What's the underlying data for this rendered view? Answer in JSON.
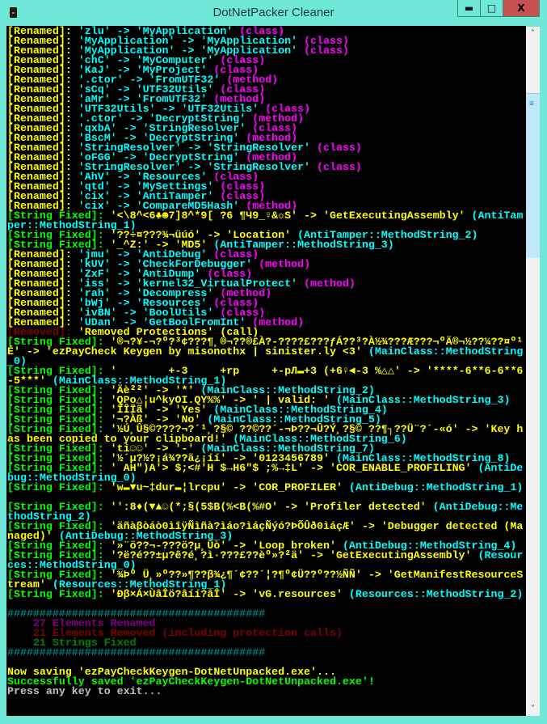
{
  "window": {
    "title": "DotNetPacker Cleaner",
    "minimize": "▬",
    "maximize": "□",
    "close": "X"
  },
  "colors": {
    "yellow": "#ffff00",
    "cyan": "#00ffff",
    "magenta": "#ff00ff",
    "green": "#00ff00",
    "darkred": "#800000",
    "purple": "#800080",
    "darkgreen": "#008000",
    "teal": "#008080",
    "gray": "#c0c0c0"
  },
  "lines": [
    {
      "type": "renamed",
      "label": "[Renamed]: ",
      "body": "'zlu' -> 'MyApplication' ",
      "tag": "(class)"
    },
    {
      "type": "renamed",
      "label": "[Renamed]: ",
      "body": "'MyApplication' -> 'MyApplication' ",
      "tag": "(class)"
    },
    {
      "type": "renamed",
      "label": "[Renamed]: ",
      "body": "'MyApplication' -> 'MyApplication' ",
      "tag": "(class)"
    },
    {
      "type": "renamed",
      "label": "[Renamed]: ",
      "body": "'chC' -> 'MyComputer' ",
      "tag": "(class)"
    },
    {
      "type": "renamed",
      "label": "[Renamed]: ",
      "body": "'KaJ' -> 'MyProject' ",
      "tag": "(class)"
    },
    {
      "type": "renamed",
      "label": "[Renamed]: ",
      "body": "'.ctor' -> 'FromUTF32' ",
      "tag": "(method)"
    },
    {
      "type": "renamed",
      "label": "[Renamed]: ",
      "body": "'sCq' -> 'UTF32Utils' ",
      "tag": "(class)"
    },
    {
      "type": "renamed",
      "label": "[Renamed]: ",
      "body": "'aMr' -> 'FromUTF32' ",
      "tag": "(method)"
    },
    {
      "type": "renamed",
      "label": "[Renamed]: ",
      "body": "'UTF32Utils' -> 'UTF32Utils' ",
      "tag": "(class)"
    },
    {
      "type": "renamed",
      "label": "[Renamed]: ",
      "body": "'.ctor' -> 'DecryptString' ",
      "tag": "(method)"
    },
    {
      "type": "renamed",
      "label": "[Renamed]: ",
      "body": "'qxbA' -> 'StringResolver' ",
      "tag": "(class)"
    },
    {
      "type": "renamed",
      "label": "[Renamed]: ",
      "body": "'BscM' -> 'DecryptString' ",
      "tag": "(method)"
    },
    {
      "type": "renamed",
      "label": "[Renamed]: ",
      "body": "'StringResolver' -> 'StringResolver' ",
      "tag": "(class)"
    },
    {
      "type": "renamed",
      "label": "[Renamed]: ",
      "body": "'oFGG' -> 'DecryptString' ",
      "tag": "(method)"
    },
    {
      "type": "renamed",
      "label": "[Renamed]: ",
      "body": "'StringResolver' -> 'StringResolver' ",
      "tag": "(class)"
    },
    {
      "type": "renamed",
      "label": "[Renamed]: ",
      "body": "'AhV' -> 'Resources' ",
      "tag": "(class)"
    },
    {
      "type": "renamed",
      "label": "[Renamed]: ",
      "body": "'qtd' -> 'MySettings' ",
      "tag": "(class)"
    },
    {
      "type": "renamed",
      "label": "[Renamed]: ",
      "body": "'cix' -> 'AntiTamper' ",
      "tag": "(class)"
    },
    {
      "type": "renamed",
      "label": "[Renamed]: ",
      "body": "'cix' -> 'CompareMD5Hash' ",
      "tag": "(method)"
    },
    {
      "type": "string",
      "label": "[String Fixed]: ",
      "body": "'<\\8^<6♣☻7]8^*9[ ?6 ¶Ч9_♀&☼S' -> 'GetExecutingAssembly' ",
      "tag": "(AntiTamper::MethodString_1)"
    },
    {
      "type": "string",
      "label": "[String Fixed]: ",
      "body": "'??÷¤???¾¬üúó' -> 'Location' ",
      "tag": "(AntiTamper::MethodString_2)"
    },
    {
      "type": "string",
      "label": "[String Fixed]: ",
      "body": "'_^Z:' -> 'MD5' ",
      "tag": "(AntiTamper::MethodString_3)"
    },
    {
      "type": "renamed",
      "label": "[Renamed]: ",
      "body": "'jmu' -> 'AntiDebug' ",
      "tag": "(class)"
    },
    {
      "type": "renamed",
      "label": "[Renamed]: ",
      "body": "'kUV' -> 'CheckForDebugger' ",
      "tag": "(method)"
    },
    {
      "type": "renamed",
      "label": "[Renamed]: ",
      "body": "'ZxF' -> 'AntiDump' ",
      "tag": "(class)"
    },
    {
      "type": "renamed",
      "label": "[Renamed]: ",
      "body": "'iss' -> 'kernel32_VirtualProtect' ",
      "tag": "(method)"
    },
    {
      "type": "renamed",
      "label": "[Renamed]: ",
      "body": "'rah' -> 'Decompress' ",
      "tag": "(method)"
    },
    {
      "type": "renamed",
      "label": "[Renamed]: ",
      "body": "'bWj' -> 'Resources' ",
      "tag": "(class)"
    },
    {
      "type": "renamed",
      "label": "[Renamed]: ",
      "body": "'ivBN' -> 'BoolUtils' ",
      "tag": "(class)"
    },
    {
      "type": "renamed",
      "label": "[Renamed]: ",
      "body": "'UDan' -> 'GetBoolFromInt' ",
      "tag": "(method)"
    },
    {
      "type": "removed",
      "label": "[Removed]: ",
      "body": "'Removed Protections' ",
      "tag": "(call)"
    },
    {
      "type": "string",
      "label": "[String Fixed]: ",
      "body": "'®¬?¥-¬?º?³¢???¶¸®¬??®£À?-????£???ƒÁ??³?À½¾???Æ???¬ºÄ®¬½??¼??¤º¹É' -> 'ezPayCheck Keygen by misonothx | sinister.ly <3' ",
      "tag": "(MainClass::MethodString_0)"
    },
    {
      "type": "string",
      "label": "[String Fixed]: ",
      "body": "'        +-3     +rp     +-pЛ▬+3 (+6♀◄-3 %△△' -> '****-6**6-6**6-5***' ",
      "tag": "(MainClass::MethodString_1)"
    },
    {
      "type": "string",
      "label": "[String Fixed]: ",
      "body": "'Äè²²' -> '*' ",
      "tag": "(MainClass::MethodString_2)"
    },
    {
      "type": "string",
      "label": "[String Fixed]: ",
      "body": "'QPo△¦u^kyOI.QY%%' -> ' | valid: ' ",
      "tag": "(MainClass::MethodString_3)"
    },
    {
      "type": "string",
      "label": "[String Fixed]: ",
      "body": "'ÎÎÏã' -> 'Yes' ",
      "tag": "(MainClass::MethodString_4)"
    },
    {
      "type": "string",
      "label": "[String Fixed]: ",
      "body": "'¬?Àß' -> 'No' ",
      "tag": "(MainClass::MethodString_5)"
    },
    {
      "type": "string",
      "label": "[String Fixed]: ",
      "body": "'½Ú¸Û§©????¬?´¹¸?§© ??©??´-¬Þ??¬Û?Ý¸?§© ??¶┐??Ü¨?´-«ó' -> 'Key has been copied to your clipboard!' ",
      "tag": "(MainClass::MethodString_6)"
    },
    {
      "type": "string",
      "label": "[String Fixed]: ",
      "body": "'ti☺☺' -> '-' ",
      "tag": "(MainClass::MethodString_7)"
    },
    {
      "type": "string",
      "label": "[String Fixed]: ",
      "body": "'½´µ?½?¡á¾??ä¿¡íí' -> '0123456789' ",
      "tag": "(MainClass::MethodString_8)"
    },
    {
      "type": "string",
      "label": "[String Fixed]: ",
      "body": "' AH\")A'> $;<#'H $→H6\"$ ;%→‡L' -> 'COR_ENABLE_PROFILING' ",
      "tag": "(AntiDebug::MethodString_0)"
    },
    {
      "type": "string",
      "label": "[String Fixed]: ",
      "body": "'w▬▼u~‡dur▬¦lrcpu' -> 'COR_PROFILER' ",
      "tag": "(AntiDebug::MethodString_1)"
    },
    {
      "type": "blank"
    },
    {
      "type": "string",
      "label": "[String Fixed]: ",
      "body": "'':8♦(▼▲☺(*;§(5$B(%<B(%#O' -> 'Profiler detected' ",
      "tag": "(AntiDebug::MethodString_2)"
    },
    {
      "type": "string",
      "label": "[String Fixed]: ",
      "body": "'äñàβòáò0ìîÿÑìñà?ìáo?ìáçÑýó?ÞÕÛð0ìáçÆ' -> 'Debugger detected (Managed)' ",
      "tag": "(AntiDebug::MethodString_3)"
    },
    {
      "type": "string",
      "label": "[String Fixed]: ",
      "body": "'»¨ö??¬-???ö?µ¸Ûò' -> 'Loop broken' ",
      "tag": "(AntiDebug::MethodString_4)"
    },
    {
      "type": "string",
      "label": "[String Fixed]: ",
      "body": "'?ë?é??±µ?ê?é¸?ì·???£??èº»?²ä' -> 'GetExecutingAssembly' ",
      "tag": "(Resources::MethodString_0)"
    },
    {
      "type": "string",
      "label": "[String Fixed]: ",
      "body": "'¾Þº Ü¸»º??»¶??β¾¿¶´¢??´¦?¶º¢Ü??º??½ÑÑ' -> 'GetManifestResourceStream' ",
      "tag": "(Resources::MethodString_1)"
    },
    {
      "type": "string",
      "label": "[String Fixed]: ",
      "body": "'Ðβ×Á×ÙâÎö?âíí?âÎ' -> 'vG.resources' ",
      "tag": "(Resources::MethodString_2)"
    },
    {
      "type": "blank"
    },
    {
      "type": "plain",
      "color": "teal",
      "text": "########################################"
    },
    {
      "type": "plain",
      "color": "purple",
      "text": "    27 Elements Renamed"
    },
    {
      "type": "plain",
      "color": "darkred",
      "text": "    21 Elements Removed (including protection calls)"
    },
    {
      "type": "plain",
      "color": "darkgreen",
      "text": "    21 Strings Fixed"
    },
    {
      "type": "plain",
      "color": "teal",
      "text": "########################################"
    },
    {
      "type": "blank"
    },
    {
      "type": "plain",
      "color": "yellow",
      "text": "Now saving 'ezPayCheckKeygen-DotNetUnpacked.exe'..."
    },
    {
      "type": "plain",
      "color": "green",
      "text": "Successfully saved 'ezPayCheckKeygen-DotNetUnpacked.exe'!"
    },
    {
      "type": "plain",
      "color": "gray",
      "text": "Press any key to exit..."
    }
  ],
  "scrollbar": {
    "up": "˄",
    "down": "˅",
    "grip": "≡"
  }
}
